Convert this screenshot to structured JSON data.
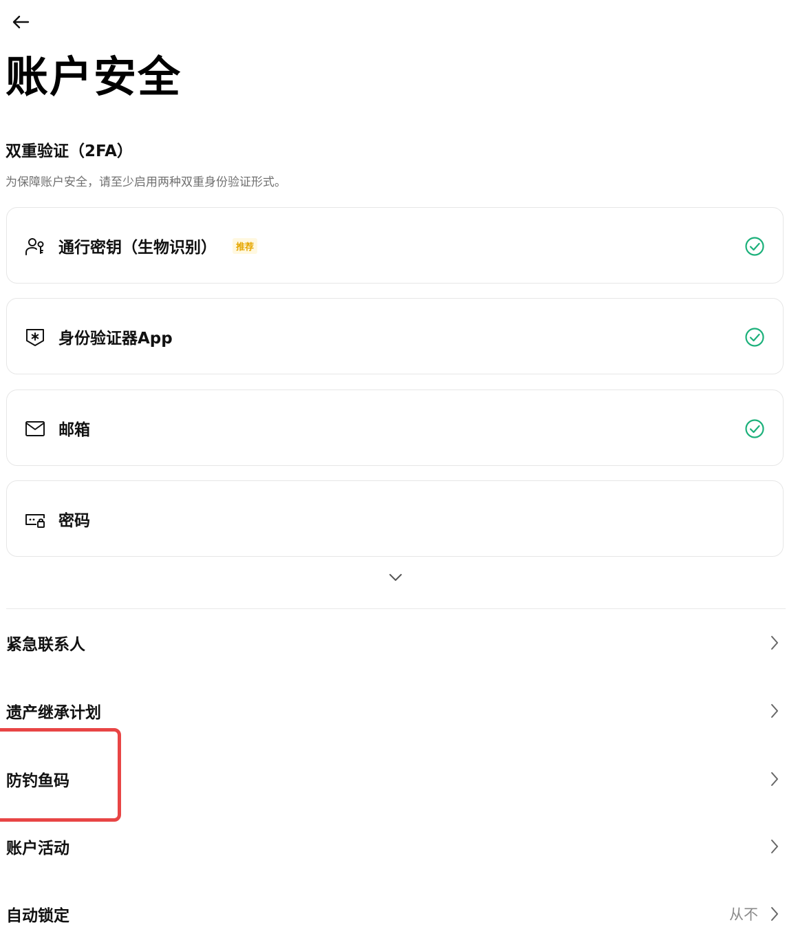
{
  "header": {
    "back_icon": "arrow-left-icon",
    "title": "账户安全"
  },
  "twofa": {
    "title": "双重验证（2FA）",
    "description": "为保障账户安全，请至少启用两种双重身份验证形式。",
    "methods": [
      {
        "label": "通行密钥（生物识别）",
        "badge": "推荐",
        "icon": "passkey-user-icon",
        "status": "enabled"
      },
      {
        "label": "身份验证器App",
        "icon": "shield-asterisk-icon",
        "status": "enabled"
      },
      {
        "label": "邮箱",
        "icon": "mail-icon",
        "status": "enabled"
      },
      {
        "label": "密码",
        "icon": "password-lock-icon",
        "status": "none"
      }
    ],
    "expand_icon": "chevron-down-icon"
  },
  "settings": {
    "items": [
      {
        "label": "紧急联系人",
        "value": ""
      },
      {
        "label": "遗产继承计划",
        "value": ""
      },
      {
        "label": "防钓鱼码",
        "value": "",
        "highlighted": true
      },
      {
        "label": "账户活动",
        "value": ""
      },
      {
        "label": "自动锁定",
        "value": "从不"
      }
    ]
  },
  "colors": {
    "accent_green": "#1bb07a",
    "badge_text": "#e6a700",
    "badge_bg": "#fff8e0",
    "highlight": "#e84545",
    "text_primary": "#111111",
    "text_secondary": "#707070"
  }
}
